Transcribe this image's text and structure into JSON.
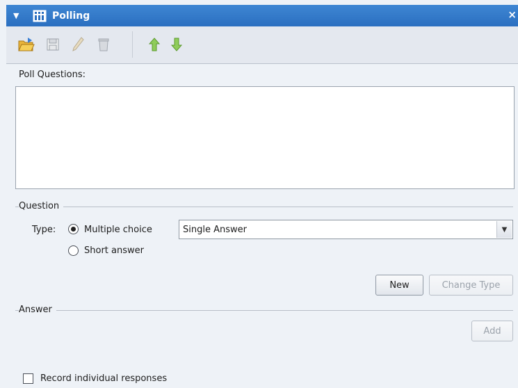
{
  "titlebar": {
    "title": "Polling",
    "collapse_icon": "triangle-down-icon",
    "close_label": "×"
  },
  "toolbar": {
    "buttons": [
      {
        "name": "open-icon",
        "enabled": true
      },
      {
        "name": "save-icon",
        "enabled": false
      },
      {
        "name": "edit-icon",
        "enabled": false
      },
      {
        "name": "delete-icon",
        "enabled": false
      },
      {
        "name": "move-up-icon",
        "enabled": true
      },
      {
        "name": "move-down-icon",
        "enabled": true
      }
    ]
  },
  "poll_questions": {
    "label": "Poll Questions:",
    "items": []
  },
  "question": {
    "group_label": "Question",
    "type_label": "Type:",
    "options": [
      "Multiple choice",
      "Short answer"
    ],
    "selected": "Multiple choice",
    "answer_mode": "Single  Answer",
    "new_label": "New",
    "change_type_label": "Change Type"
  },
  "answer": {
    "group_label": "Answer",
    "add_label": "Add"
  },
  "record_responses": {
    "label": "Record individual responses",
    "checked": false
  },
  "colors": {
    "title_bar": "#3278c8",
    "panel_bg": "#eef2f7"
  }
}
